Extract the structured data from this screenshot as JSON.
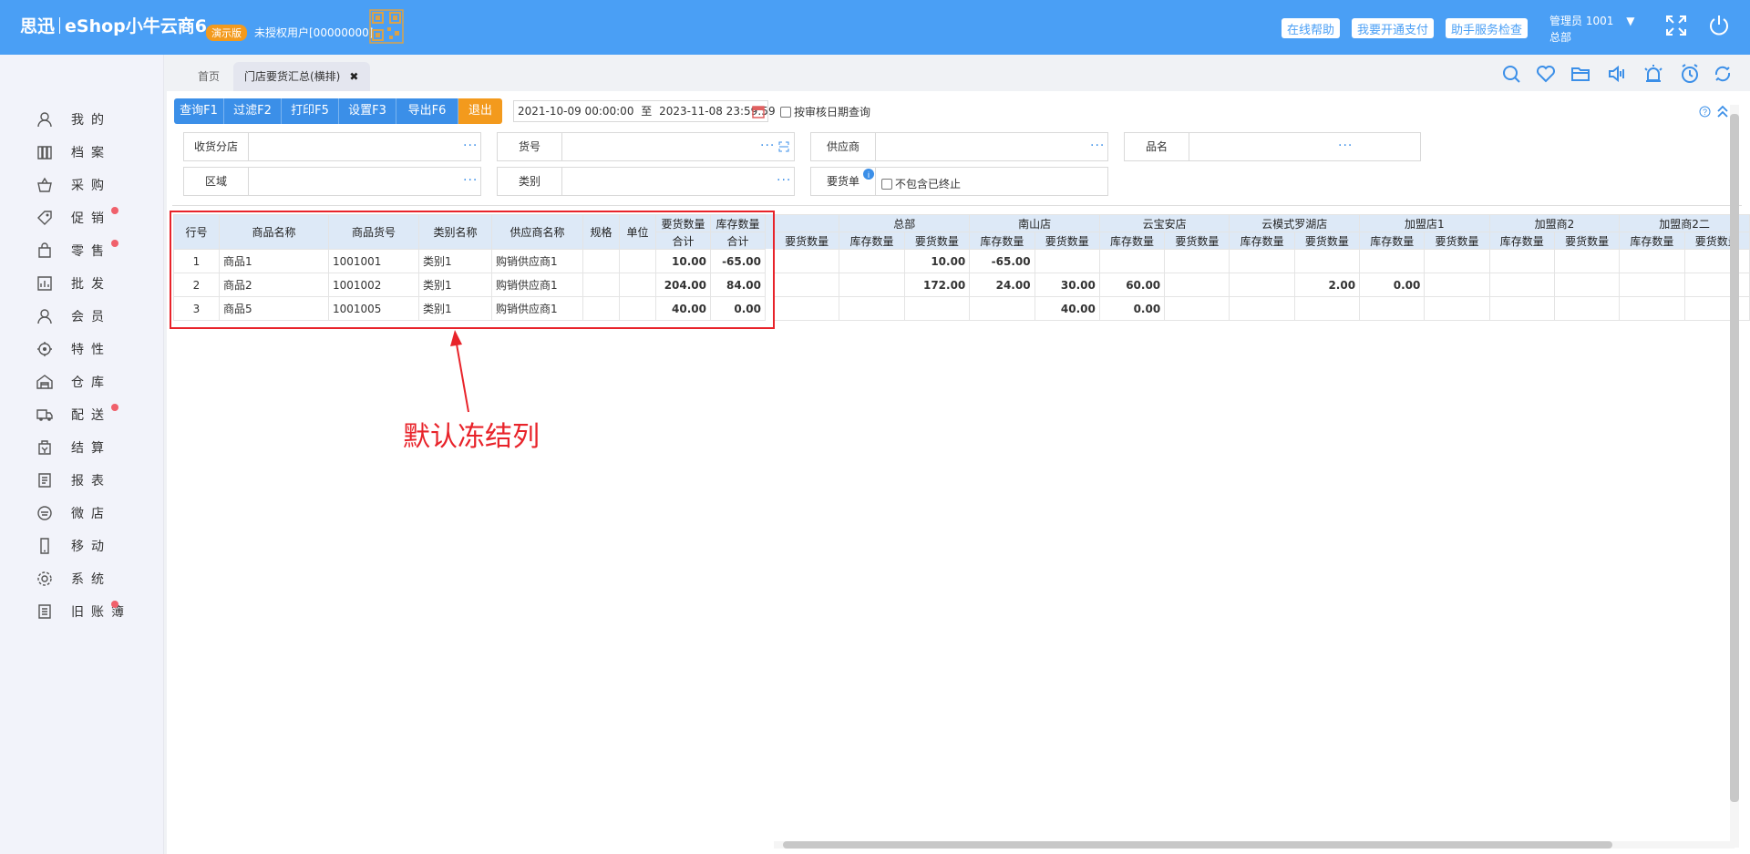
{
  "brand": {
    "name1": "思迅",
    "name2": "eShop小牛云商6",
    "demo": "演示版",
    "unauth": "未授权用户[00000000]"
  },
  "top_buttons": [
    "在线帮助",
    "我要开通支付",
    "助手服务检查"
  ],
  "user": {
    "name": "管理员 1001",
    "caret": "▼",
    "branch": "总部"
  },
  "sidebar": {
    "items": [
      {
        "label": "我的",
        "icon": "user-icon",
        "dot": false
      },
      {
        "label": "档案",
        "icon": "archive-icon",
        "dot": false
      },
      {
        "label": "采购",
        "icon": "basket-icon",
        "dot": false
      },
      {
        "label": "促销",
        "icon": "tag-icon",
        "dot": true
      },
      {
        "label": "零售",
        "icon": "bag-icon",
        "dot": true
      },
      {
        "label": "批发",
        "icon": "chart-icon",
        "dot": false
      },
      {
        "label": "会员",
        "icon": "member-icon",
        "dot": false
      },
      {
        "label": "特性",
        "icon": "target-icon",
        "dot": false
      },
      {
        "label": "仓库",
        "icon": "warehouse-icon",
        "dot": false
      },
      {
        "label": "配送",
        "icon": "truck-icon",
        "dot": true
      },
      {
        "label": "结算",
        "icon": "settle-icon",
        "dot": false
      },
      {
        "label": "报表",
        "icon": "report-icon",
        "dot": false
      },
      {
        "label": "微店",
        "icon": "shop-icon",
        "dot": false
      },
      {
        "label": "移动",
        "icon": "mobile-icon",
        "dot": false
      },
      {
        "label": "系统",
        "icon": "gear-icon",
        "dot": false
      },
      {
        "label": "旧账簿",
        "icon": "ledger-icon",
        "dot": true
      }
    ]
  },
  "tabs": {
    "home": "首页",
    "active": "门店要货汇总(横排)",
    "close": "✖"
  },
  "toolbar": {
    "buttons": [
      "查询F1",
      "过滤F2",
      "打印F5",
      "设置F3",
      "导出F6",
      "退出"
    ],
    "date_from": "2021-10-09 00:00:00",
    "date_to_sep": "至",
    "date_to": "2023-11-08 23:59:59",
    "audit_check_label": "按审核日期查询"
  },
  "filters": {
    "branch": "收货分店",
    "item_no": "货号",
    "supplier": "供应商",
    "item_name": "品名",
    "region": "区域",
    "category": "类别",
    "order": "要货单",
    "exclude_label": "不包含已终止",
    "dots": "···"
  },
  "grid": {
    "frozen_headers": [
      "行号",
      "商品名称",
      "商品货号",
      "类别名称",
      "供应商名称",
      "规格",
      "单位",
      "要货数量合计",
      "库存数量合计"
    ],
    "frozen_headers_top": [
      "要货数量",
      "库存数量"
    ],
    "frozen_headers_bottom": [
      "合计",
      "合计"
    ],
    "stores": [
      "总部",
      "南山店",
      "云宝安店",
      "云模式罗湖店",
      "加盟店1",
      "加盟商2",
      "加盟商2二"
    ],
    "sub_headers": [
      "要货数量",
      "库存数量"
    ],
    "rows": [
      {
        "no": "1",
        "name": "商品1",
        "code": "1001001",
        "cat": "类别1",
        "supplier": "购销供应商1",
        "spec": "",
        "unit": "",
        "req": "10.00",
        "stock": "-65.00",
        "cells": [
          "",
          "",
          "10.00",
          "-65.00",
          "",
          "",
          "",
          "",
          "",
          "",
          "",
          "",
          "",
          "",
          ""
        ]
      },
      {
        "no": "2",
        "name": "商品2",
        "code": "1001002",
        "cat": "类别1",
        "supplier": "购销供应商1",
        "spec": "",
        "unit": "",
        "req": "204.00",
        "stock": "84.00",
        "cells": [
          "",
          "",
          "172.00",
          "24.00",
          "30.00",
          "60.00",
          "",
          "",
          "2.00",
          "0.00",
          "",
          "",
          "",
          "",
          ""
        ]
      },
      {
        "no": "3",
        "name": "商品5",
        "code": "1001005",
        "cat": "类别1",
        "supplier": "购销供应商1",
        "spec": "",
        "unit": "",
        "req": "40.00",
        "stock": "0.00",
        "cells": [
          "",
          "",
          "",
          "",
          "40.00",
          "0.00",
          "",
          "",
          "",
          "",
          "",
          "",
          "",
          "",
          ""
        ]
      }
    ]
  },
  "annotation": {
    "text": "默认冻结列",
    "color": "#e8232a"
  },
  "colors": {
    "topbar": "#4a9ff5",
    "button": "#3b8fe8",
    "exit": "#f39a1d",
    "dot": "#f0606b"
  }
}
